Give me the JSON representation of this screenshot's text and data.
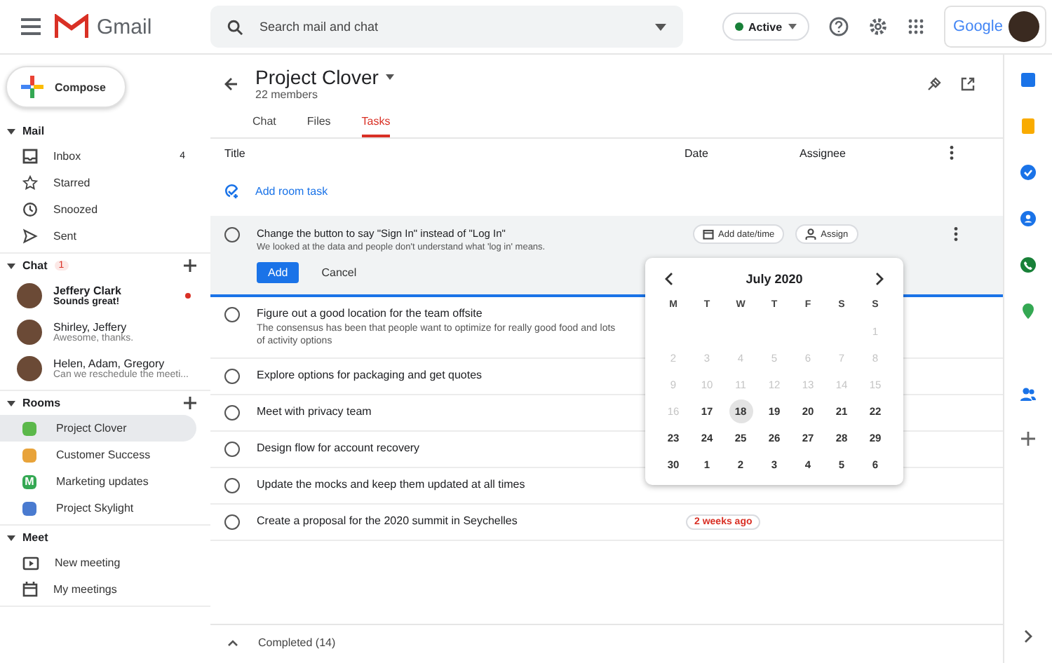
{
  "topbar": {
    "product": "Gmail",
    "search": {
      "placeholder": "Search mail and chat"
    },
    "status": {
      "label": "Active",
      "on": true
    },
    "account": {
      "brand": "Google"
    }
  },
  "sidebar": {
    "compose": "Compose",
    "sections": [
      {
        "kind": "mail",
        "title": "Mail",
        "expanded": true,
        "items": [
          {
            "label": "Inbox",
            "count": "4"
          },
          {
            "label": "Starred"
          },
          {
            "label": "Snoozed"
          },
          {
            "label": "Sent"
          }
        ]
      },
      {
        "kind": "chat",
        "title": "Chat",
        "badge": "1",
        "expanded": true,
        "items": [
          {
            "name": "Jeffery Clark",
            "preview": "Sounds great!",
            "unread": true
          },
          {
            "name": "Shirley, Jeffery",
            "preview": "Awesome, thanks.",
            "unread": false
          },
          {
            "name": "Helen, Adam, Gregory",
            "preview": "Can we reschedule the meeti...",
            "unread": false
          }
        ]
      },
      {
        "kind": "rooms",
        "title": "Rooms",
        "expanded": true,
        "items": [
          {
            "label": "Project Clover",
            "selected": true,
            "color": "#5bb84a"
          },
          {
            "label": "Customer Success",
            "selected": false,
            "color": "#e8a33a"
          },
          {
            "label": "Marketing updates",
            "selected": false,
            "color": "#34a853",
            "glyph": "M"
          },
          {
            "label": "Project Skylight",
            "selected": false,
            "color": "#4a7bd0"
          }
        ]
      },
      {
        "kind": "meet",
        "title": "Meet",
        "expanded": true,
        "items": [
          {
            "label": "New meeting"
          },
          {
            "label": "My meetings"
          }
        ]
      }
    ]
  },
  "room": {
    "title": "Project Clover",
    "members": "22 members",
    "tabs": [
      {
        "label": "Chat",
        "selected": false
      },
      {
        "label": "Files",
        "selected": false
      },
      {
        "label": "Tasks",
        "selected": true
      }
    ]
  },
  "table": {
    "columns": [
      "Title",
      "Date",
      "Assignee"
    ],
    "add_task": "Add room task",
    "editing": {
      "checked": false,
      "title": "Change the button to say \"Sign In\" instead of \"Log In\"",
      "description": "We looked at the data and people don't understand what 'log in' means.",
      "add": "Add",
      "cancel": "Cancel",
      "date_chip": "Add date/time",
      "assign_chip": "Assign"
    },
    "tasks": [
      {
        "checked": false,
        "title": "Figure out a good location for the team offsite",
        "description": "The consensus has been that people want to optimize for really good food and lots of activity options"
      },
      {
        "checked": false,
        "title": "Explore options for packaging and get quotes"
      },
      {
        "checked": false,
        "title": "Meet with privacy team"
      },
      {
        "checked": false,
        "title": "Design flow for account recovery"
      },
      {
        "checked": false,
        "title": "Update the mocks and keep them updated at all times"
      },
      {
        "checked": false,
        "title": "Create a proposal for the 2020 summit in Seychelles",
        "date": "2 weeks ago",
        "overdue": true
      }
    ],
    "completed": "Completed (14)"
  },
  "calendar": {
    "month": "July 2020",
    "weekdays": [
      "M",
      "T",
      "W",
      "T",
      "F",
      "S",
      "S"
    ],
    "weeks": [
      [
        {
          "label": "1",
          "disabled": true,
          "selected": false
        }
      ],
      [
        {
          "label": "2",
          "disabled": true,
          "selected": false
        },
        {
          "label": "3",
          "disabled": true,
          "selected": false
        },
        {
          "label": "4",
          "disabled": true,
          "selected": false
        },
        {
          "label": "5",
          "disabled": true,
          "selected": false
        },
        {
          "label": "6",
          "disabled": true,
          "selected": false
        },
        {
          "label": "7",
          "disabled": true,
          "selected": false
        },
        {
          "label": "8",
          "disabled": true,
          "selected": false
        }
      ],
      [
        {
          "label": "9",
          "disabled": true,
          "selected": false
        },
        {
          "label": "10",
          "disabled": true,
          "selected": false
        },
        {
          "label": "11",
          "disabled": true,
          "selected": false
        },
        {
          "label": "12",
          "disabled": true,
          "selected": false
        },
        {
          "label": "13",
          "disabled": true,
          "selected": false
        },
        {
          "label": "14",
          "disabled": true,
          "selected": false
        },
        {
          "label": "15",
          "disabled": true,
          "selected": false
        }
      ],
      [
        {
          "label": "16",
          "disabled": true,
          "selected": false
        },
        {
          "label": "17",
          "disabled": false,
          "selected": false
        },
        {
          "label": "18",
          "disabled": false,
          "selected": true
        },
        {
          "label": "19",
          "disabled": false,
          "selected": false
        },
        {
          "label": "20",
          "disabled": false,
          "selected": false
        },
        {
          "label": "21",
          "disabled": false,
          "selected": false
        },
        {
          "label": "22",
          "disabled": false,
          "selected": false
        }
      ],
      [
        {
          "label": "23",
          "disabled": false,
          "selected": false
        },
        {
          "label": "24",
          "disabled": false,
          "selected": false
        },
        {
          "label": "25",
          "disabled": false,
          "selected": false
        },
        {
          "label": "26",
          "disabled": false,
          "selected": false
        },
        {
          "label": "27",
          "disabled": false,
          "selected": false
        },
        {
          "label": "28",
          "disabled": false,
          "selected": false
        },
        {
          "label": "29",
          "disabled": false,
          "selected": false
        }
      ],
      [
        {
          "label": "30",
          "disabled": false,
          "selected": false
        },
        {
          "label": "1",
          "disabled": false,
          "selected": false
        },
        {
          "label": "2",
          "disabled": false,
          "selected": false
        },
        {
          "label": "3",
          "disabled": false,
          "selected": false
        },
        {
          "label": "4",
          "disabled": false,
          "selected": false
        },
        {
          "label": "5",
          "disabled": false,
          "selected": false
        },
        {
          "label": "6",
          "disabled": false,
          "selected": false
        }
      ]
    ]
  },
  "rail": {
    "apps": [
      {
        "color": "#1a73e8"
      },
      {
        "color": "#f9ab00"
      },
      {
        "color": "#1a73e8"
      },
      {
        "color": "#1a73e8"
      },
      {
        "color": "#188038"
      },
      {
        "color": "#34a853"
      },
      {
        "color": "#1a73e8"
      }
    ]
  }
}
